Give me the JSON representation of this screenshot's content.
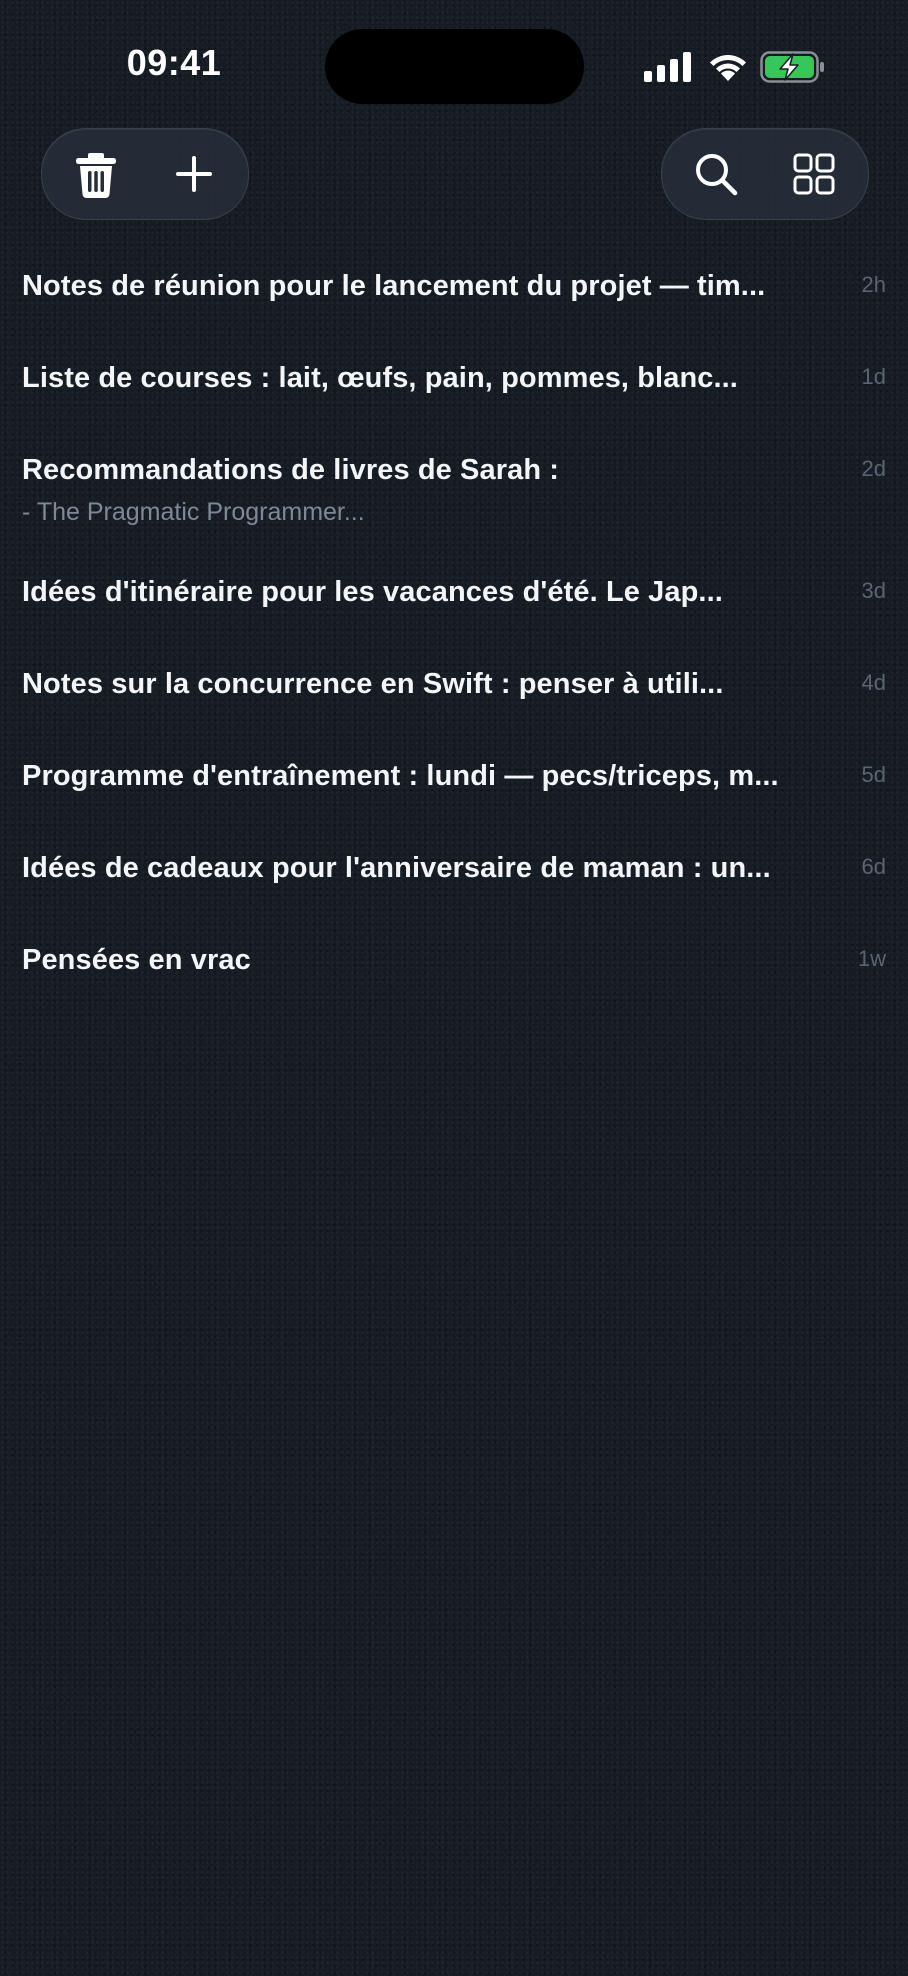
{
  "status_bar": {
    "time": "09:41",
    "battery_color": "#34c759",
    "icons": [
      "signal-icon",
      "wifi-icon",
      "battery-charging-icon"
    ]
  },
  "toolbar": {
    "left": [
      "trash-icon",
      "plus-icon"
    ],
    "right": [
      "search-icon",
      "grid-icon"
    ]
  },
  "notes": [
    {
      "title": "Notes de réunion pour le lancement du projet — tim...",
      "subtitle": "",
      "age": "2h"
    },
    {
      "title": "Liste de courses : lait, œufs, pain, pommes, blanc...",
      "subtitle": "",
      "age": "1d"
    },
    {
      "title": "Recommandations de livres de Sarah :",
      "subtitle": "- The Pragmatic Programmer...",
      "age": "2d"
    },
    {
      "title": "Idées d'itinéraire pour les vacances d'été. Le Jap...",
      "subtitle": "",
      "age": "3d"
    },
    {
      "title": "Notes sur la concurrence en Swift : penser à utili...",
      "subtitle": "",
      "age": "4d"
    },
    {
      "title": "Programme d'entraînement : lundi — pecs/triceps, m...",
      "subtitle": "",
      "age": "5d"
    },
    {
      "title": "Idées de cadeaux pour l'anniversaire de maman : un...",
      "subtitle": "",
      "age": "6d"
    },
    {
      "title": "Pensées en vrac",
      "subtitle": "",
      "age": "1w"
    }
  ],
  "colors": {
    "background": "#161c24",
    "title_text": "#f3f5f8",
    "subtitle_text": "#7f8896",
    "age_text": "#5b6472"
  }
}
